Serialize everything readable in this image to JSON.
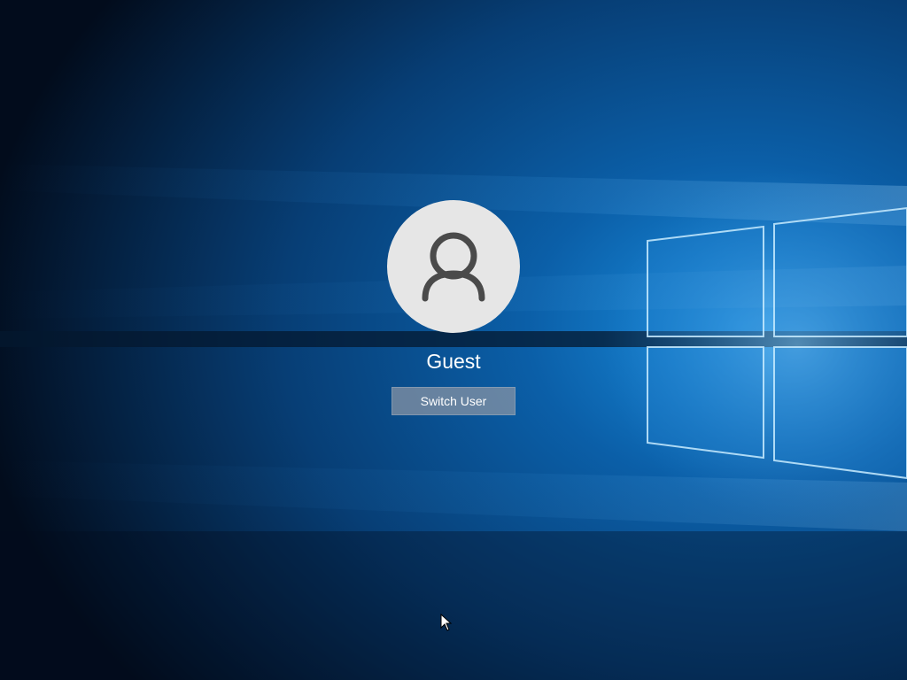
{
  "lock_screen": {
    "user_name": "Guest",
    "switch_user_label": "Switch User"
  },
  "icons": {
    "avatar": "user-silhouette-icon",
    "cursor": "mouse-pointer-icon"
  },
  "colors": {
    "background_dark": "#020c1c",
    "background_blue": "#0a4f93",
    "window_glow": "#b8e6ff",
    "avatar_bg": "#e6e6e6",
    "avatar_icon": "#4a4a4a",
    "button_bg": "#8c96a5",
    "text": "#ffffff"
  }
}
